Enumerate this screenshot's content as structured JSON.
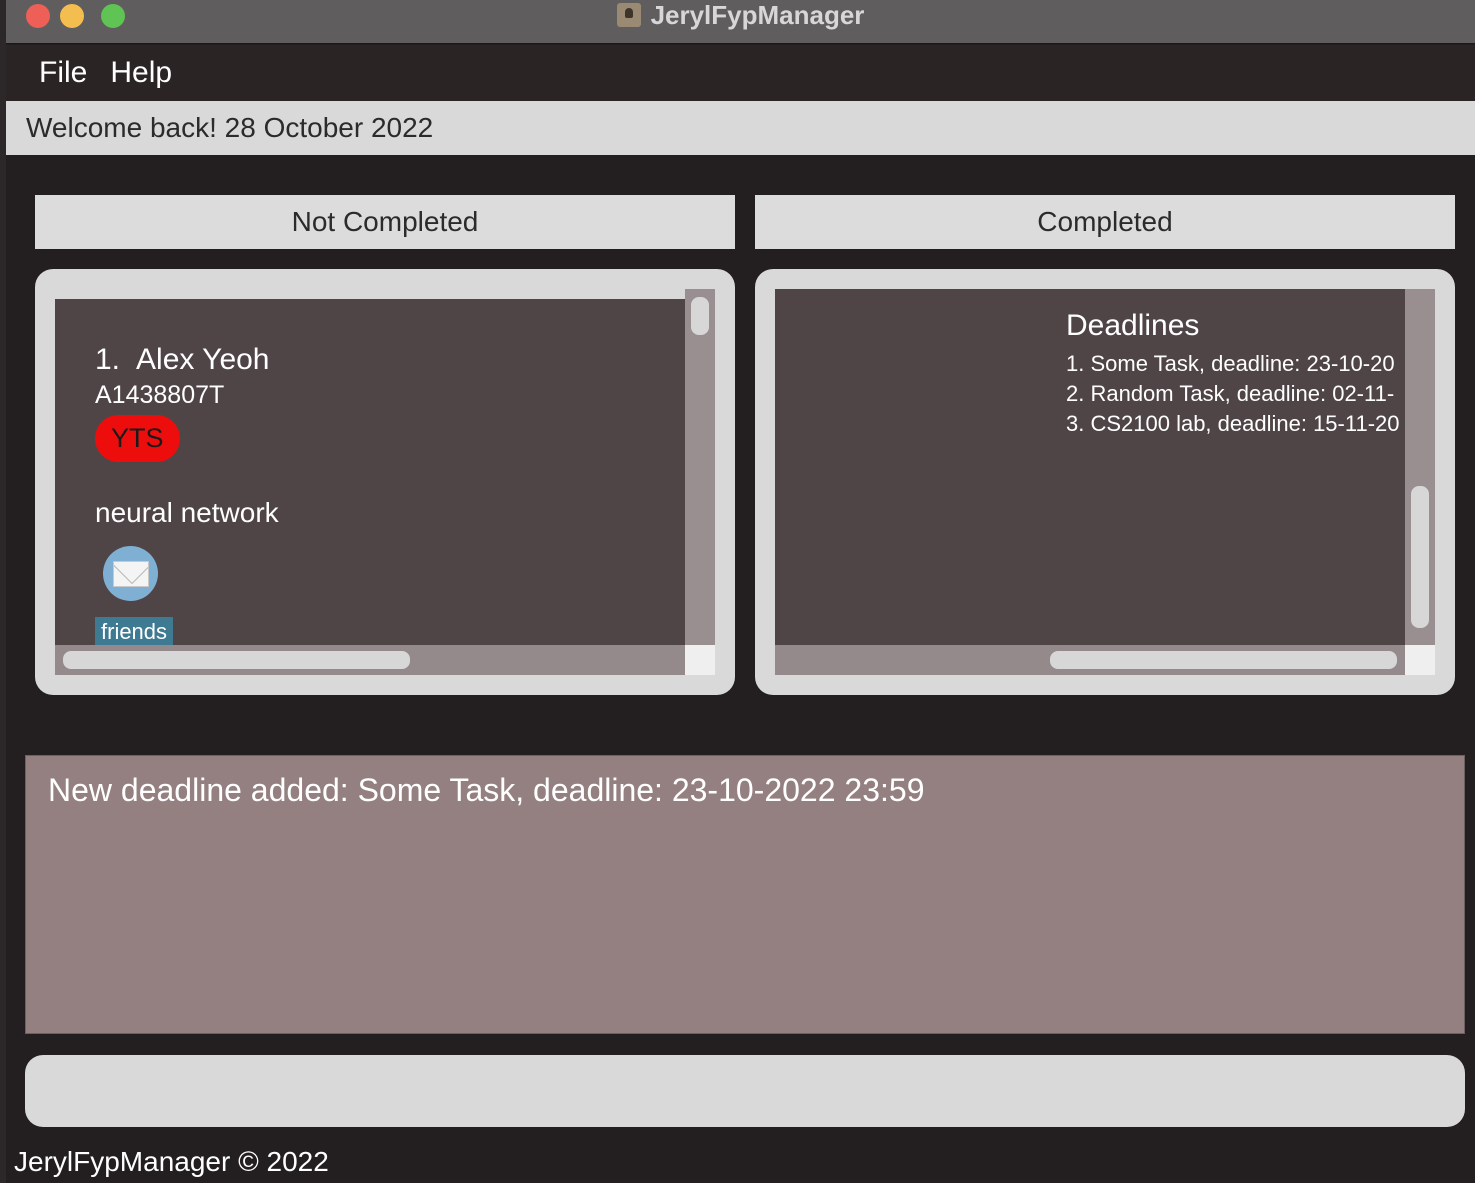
{
  "window": {
    "title": "JerylFypManager"
  },
  "menu": {
    "items": [
      "File",
      "Help"
    ]
  },
  "welcome": "Welcome back! 28 October 2022",
  "columns": {
    "not_completed": "Not Completed",
    "completed": "Completed"
  },
  "not_completed_list": {
    "items": [
      {
        "index": "1.",
        "name": "Alex Yeoh",
        "student_id": "A1438807T",
        "status_tag": "YTS",
        "project": "neural network",
        "tags": [
          "friends"
        ]
      }
    ]
  },
  "deadlines": {
    "title": "Deadlines",
    "items": [
      "1. Some Task, deadline: 23-10-20",
      "2. Random Task, deadline: 02-11-",
      "3. CS2100 lab, deadline: 15-11-20"
    ]
  },
  "result": {
    "message": "New deadline added: Some Task, deadline: 23-10-2022 23:59"
  },
  "command": {
    "value": ""
  },
  "status_bar": {
    "text": "JerylFypManager © 2022"
  },
  "colors": {
    "status_yts": "#ee0d0d",
    "tag": "#3f7a93",
    "result_bg": "#958081"
  }
}
